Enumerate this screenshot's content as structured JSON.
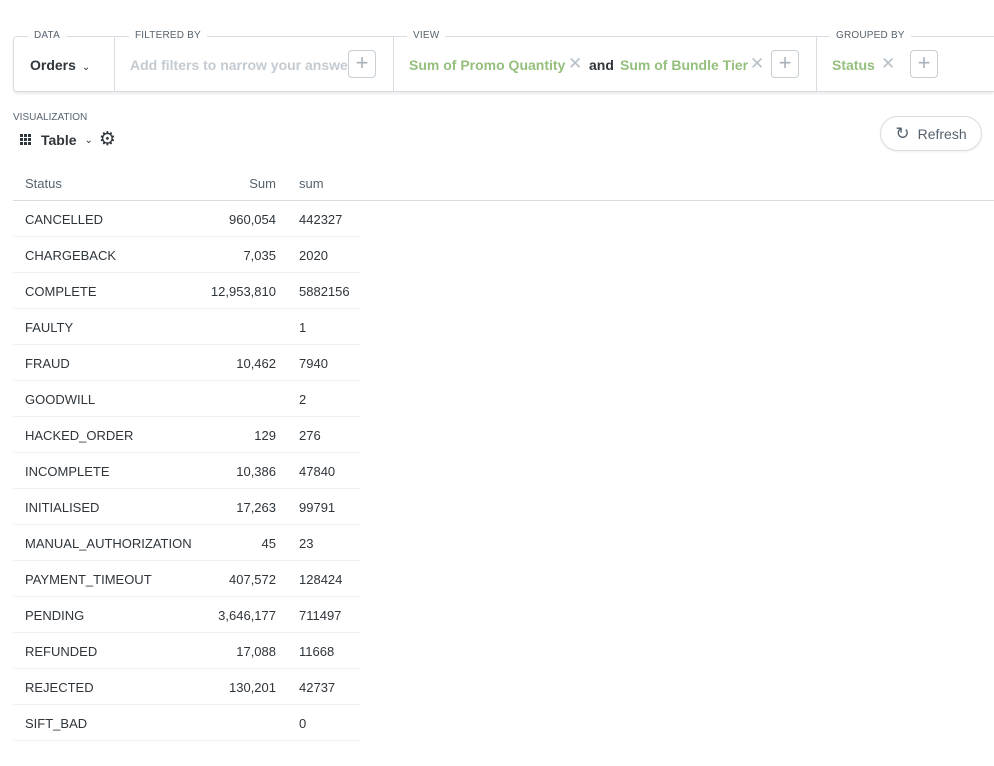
{
  "query": {
    "data": {
      "label": "DATA",
      "value": "Orders"
    },
    "filtered_by": {
      "label": "FILTERED BY",
      "placeholder": "Add filters to narrow your answer"
    },
    "view": {
      "label": "VIEW",
      "metric1": "Sum of Promo Quantity",
      "conjunction": "and",
      "metric2": "Sum of Bundle Tier"
    },
    "grouped_by": {
      "label": "GROUPED BY",
      "value": "Status"
    }
  },
  "visualization": {
    "label": "VISUALIZATION",
    "type": "Table"
  },
  "refresh_label": "Refresh",
  "table": {
    "headers": [
      "Status",
      "Sum",
      "sum"
    ],
    "rows": [
      [
        "CANCELLED",
        "960,054",
        "442327"
      ],
      [
        "CHARGEBACK",
        "7,035",
        "2020"
      ],
      [
        "COMPLETE",
        "12,953,810",
        "5882156"
      ],
      [
        "FAULTY",
        "",
        "1"
      ],
      [
        "FRAUD",
        "10,462",
        "7940"
      ],
      [
        "GOODWILL",
        "",
        "2"
      ],
      [
        "HACKED_ORDER",
        "129",
        "276"
      ],
      [
        "INCOMPLETE",
        "10,386",
        "47840"
      ],
      [
        "INITIALISED",
        "17,263",
        "99791"
      ],
      [
        "MANUAL_AUTHORIZATION",
        "45",
        "23"
      ],
      [
        "PAYMENT_TIMEOUT",
        "407,572",
        "128424"
      ],
      [
        "PENDING",
        "3,646,177",
        "711497"
      ],
      [
        "REFUNDED",
        "17,088",
        "11668"
      ],
      [
        "REJECTED",
        "130,201",
        "42737"
      ],
      [
        "SIFT_BAD",
        "",
        "0"
      ]
    ]
  },
  "icons": {
    "data_dropdown": "chevron-down-icon",
    "add": "plus-icon",
    "remove": "close-icon",
    "viz_type": "grid-icon",
    "settings": "gear-icon",
    "refresh": "refresh-icon"
  },
  "colors": {
    "metric_green": "#94bf7d",
    "border": "#d8dde3",
    "text": "#2e353b"
  }
}
